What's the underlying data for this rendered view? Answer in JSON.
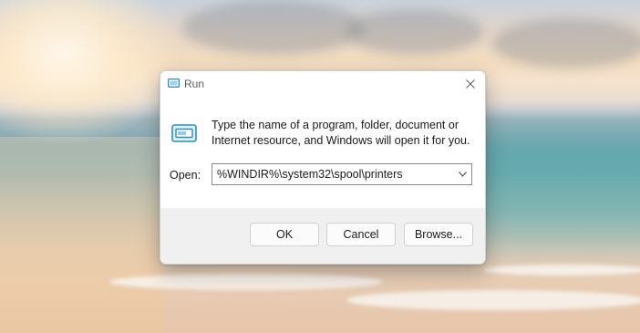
{
  "window": {
    "title": "Run",
    "close_icon": "close-icon"
  },
  "dialog": {
    "app_icon": "run-app-icon",
    "prompt_line1": "Type the name of a program, folder, document or",
    "prompt_line2": "Internet resource, and Windows will open it for you.",
    "open_label": "Open:",
    "open_value": "%WINDIR%\\system32\\spool\\printers",
    "dropdown_icon": "chevron-down-icon"
  },
  "buttons": {
    "ok": "OK",
    "cancel": "Cancel",
    "browse": "Browse..."
  },
  "colors": {
    "dialog_background": "#ffffff",
    "footer_background": "#f0f0f0",
    "icon_accent": "#2a8fbf"
  },
  "desktop": {
    "wallpaper": "sunset-beach-wallpaper"
  }
}
